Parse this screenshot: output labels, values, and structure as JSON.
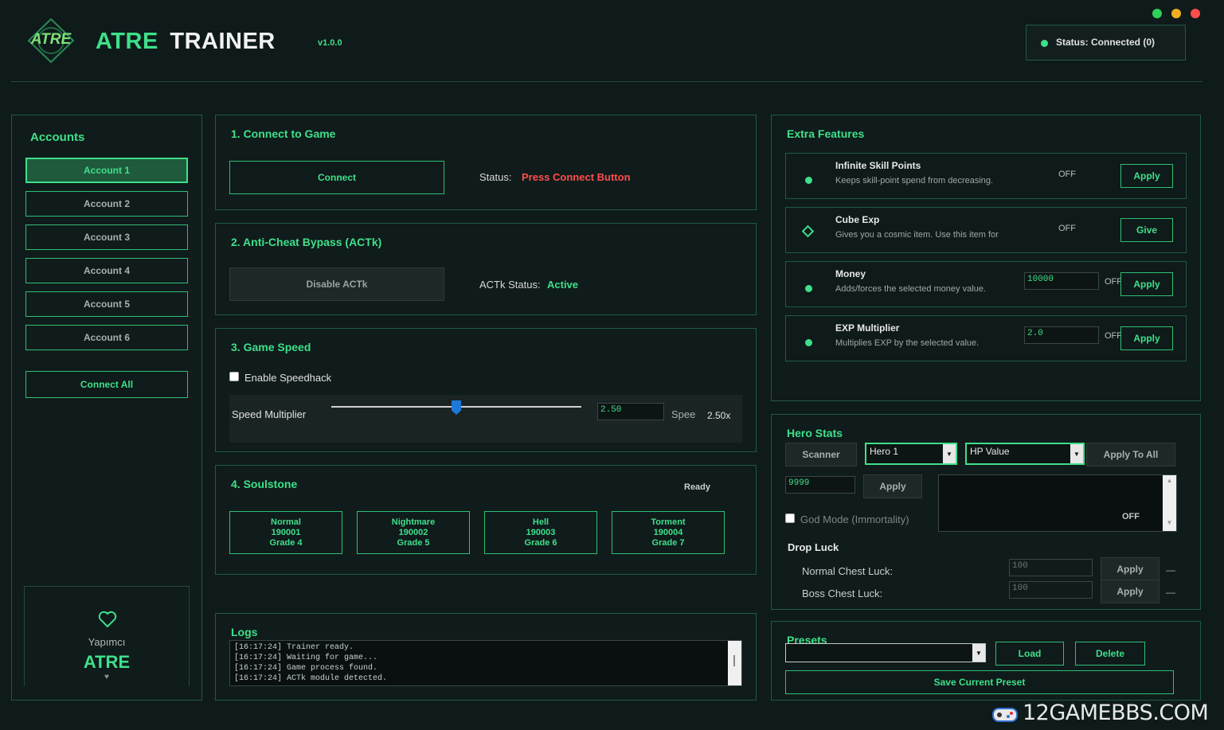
{
  "app": {
    "logo_text": "ATRE",
    "title_green": "ATRE",
    "title_white": "TRAINER",
    "version": "v1.0.0",
    "status": "Status: Connected (0)"
  },
  "colors": {
    "accent": "#3ee08a",
    "background": "#0f1a1a",
    "danger": "#ff4d4d",
    "win_green": "#2fd05a",
    "win_yellow": "#f0b020",
    "win_red": "#ff4d4d"
  },
  "accounts": {
    "title": "Accounts",
    "items": [
      "Account 1",
      "Account 2",
      "Account 3",
      "Account 4",
      "Account 5",
      "Account 6"
    ],
    "connect_all": "Connect All"
  },
  "credit": {
    "label": "Yapımcı",
    "name": "ATRE",
    "heart": "♥"
  },
  "connect": {
    "title": "1. Connect to Game",
    "button": "Connect",
    "status_label": "Status:",
    "status_value": "Press Connect Button"
  },
  "anticheat": {
    "title": "2. Anti-Cheat Bypass (ACTk)",
    "button": "Disable ACTk",
    "status_label": "ACTk Status:",
    "status_value": "Active"
  },
  "speed": {
    "title": "3. Game Speed",
    "checkbox": "Enable Speedhack",
    "slider_label": "Speed Multiplier",
    "slider_value": 0.5,
    "input": "2.50",
    "cut_label": "Spee",
    "display": "2.50x"
  },
  "soulstone": {
    "title": "4. Soulstone",
    "status": "Ready",
    "items": [
      {
        "name": "Normal",
        "id": "190001",
        "grade": "Grade 4"
      },
      {
        "name": "Nightmare",
        "id": "190002",
        "grade": "Grade 5"
      },
      {
        "name": "Hell",
        "id": "190003",
        "grade": "Grade 6"
      },
      {
        "name": "Torment",
        "id": "190004",
        "grade": "Grade 7"
      }
    ]
  },
  "logs": {
    "title": "Logs",
    "lines": [
      "[16:17:24] Trainer ready.",
      "[16:17:24] Waiting for game...",
      "[16:17:24] Game process found.",
      "[16:17:24] ACTk module detected."
    ]
  },
  "extra": {
    "title": "Extra Features",
    "items": [
      {
        "title": "Infinite Skill Points",
        "desc": "Keeps skill-point spend from decreasing.",
        "state": "OFF",
        "button": "Apply",
        "value": ""
      },
      {
        "title": "Cube Exp",
        "desc": "Gives you a cosmic item. Use this item for",
        "state": "OFF",
        "button": "Give",
        "value": ""
      },
      {
        "title": "Money",
        "desc": "Adds/forces the selected money value.",
        "state": "OFF",
        "button": "Apply",
        "value": "10000"
      },
      {
        "title": "EXP Multiplier",
        "desc": "Multiplies EXP by the selected value.",
        "state": "OFF",
        "button": "Apply",
        "value": "2.0"
      }
    ]
  },
  "hero": {
    "title": "Hero Stats",
    "scanner": "Scanner",
    "hero_select": "Hero 1",
    "stat_select": "HP Value",
    "apply_all": "Apply To All",
    "value": "9999",
    "apply": "Apply",
    "godmode": "God Mode (Immortality)",
    "box_state": "OFF"
  },
  "drop": {
    "title": "Drop Luck",
    "normal_label": "Normal Chest Luck:",
    "normal_value": "100",
    "boss_label": "Boss Chest Luck:",
    "boss_value": "100",
    "apply": "Apply",
    "dash": "—"
  },
  "presets": {
    "title": "Presets",
    "load": "Load",
    "delete": "Delete",
    "save": "Save Current Preset"
  },
  "watermark": "12GAMEBBS.COM"
}
